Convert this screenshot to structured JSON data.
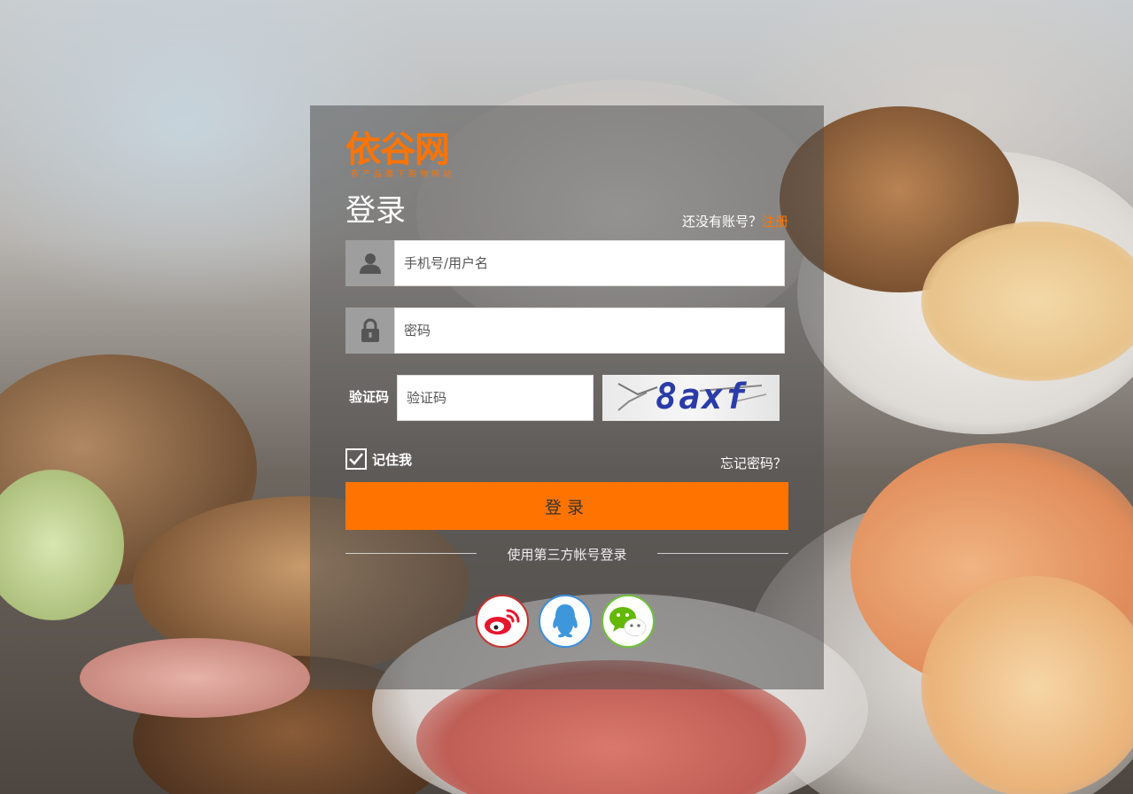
{
  "brand": {
    "logo_text": "依谷网",
    "logo_tagline": "农产品源下购物网站",
    "accent_color": "#ff7400"
  },
  "login": {
    "title": "登录",
    "no_account_text": "还没有账号？",
    "register_link": "注册",
    "username_placeholder": "手机号/用户名",
    "password_placeholder": "密码",
    "captcha_label": "验证码",
    "captcha_placeholder": "验证码",
    "captcha_code": "8axf",
    "remember_label": "记住我",
    "remember_checked": true,
    "forgot_link": "忘记密码？",
    "submit_label": "登录",
    "third_party_text": "使用第三方帐号登录"
  },
  "social_logins": [
    {
      "icon": "weibo-icon",
      "color": "#c8322e"
    },
    {
      "icon": "qq-icon",
      "color": "#3d8ed8"
    },
    {
      "icon": "wechat-icon",
      "color": "#6fc13a"
    }
  ]
}
